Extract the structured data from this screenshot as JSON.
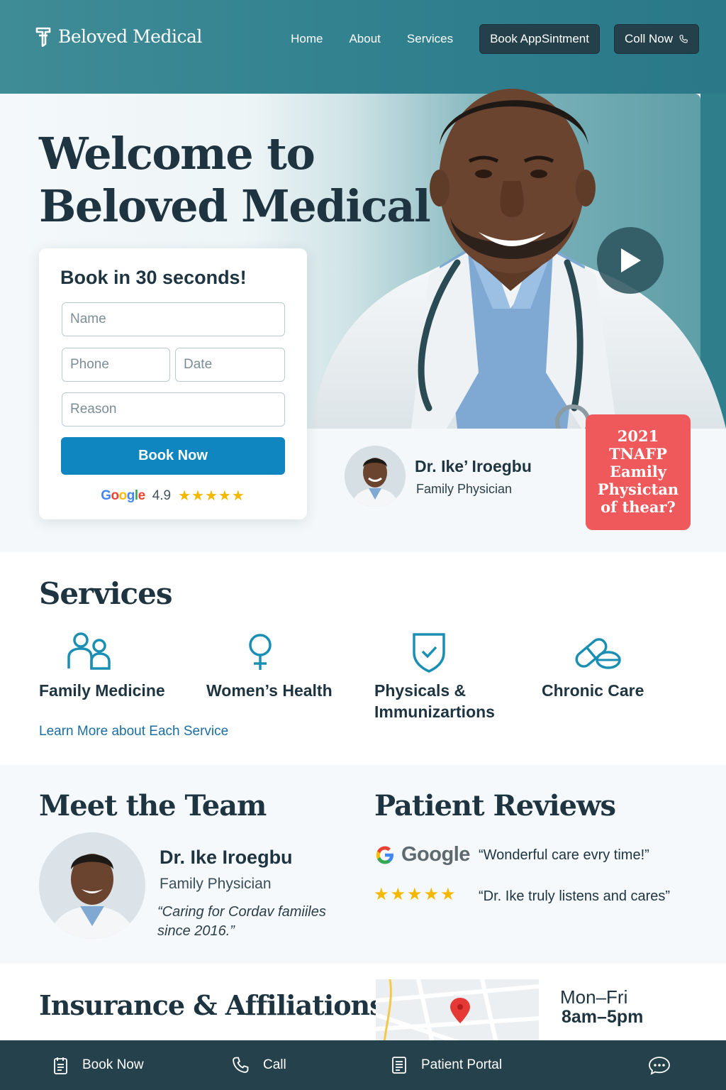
{
  "brand": {
    "name": "Beloved Medical"
  },
  "nav": {
    "links": [
      "Home",
      "About",
      "Services"
    ],
    "book_label": "Book AppSintment",
    "call_label": "Coll Now"
  },
  "hero": {
    "title_line1": "Welcome to",
    "title_line2": "Beloved Medical"
  },
  "booking": {
    "title": "Book in 30 seconds!",
    "name_placeholder": "Name",
    "phone_placeholder": "Phone",
    "date_placeholder": "Date",
    "reason_placeholder": "Reason",
    "button_label": "Book Now",
    "rating_source": "Google",
    "rating_value": "4.9",
    "rating_stars": "★★★★★"
  },
  "doctor_card": {
    "name": "Dr. Ike’ Iroegbu",
    "role": "Family Physician"
  },
  "award": {
    "line1": "2021",
    "line2": "TNAFP",
    "line3": "Eamily",
    "line4": "Physictan",
    "line5": "of thear?"
  },
  "services": {
    "heading": "Services",
    "items": [
      {
        "label": "Family Medicine",
        "icon": "family-icon"
      },
      {
        "label": "Women’s Health",
        "icon": "female-symbol-icon"
      },
      {
        "label_line1": "Physicals &",
        "label_line2": "Immunizartions",
        "icon": "shield-check-icon"
      },
      {
        "label": "Chronic Care",
        "icon": "pill-icon"
      }
    ],
    "learn_more": "Learn More about Each Service"
  },
  "team": {
    "heading": "Meet the Team",
    "name": "Dr. Ike Iroegbu",
    "role": "Family Physician",
    "quote": "“Caring for Cordav famiiles since 2016.”"
  },
  "reviews": {
    "heading": "Patient Reviews",
    "source": "Google",
    "stars": "★★★★★",
    "quote1": "“Wonderful care evry time!”",
    "quote2": "“Dr. Ike truly listens and cares”"
  },
  "insurance": {
    "heading": "Insurance & Affiliations",
    "days": "Mon–Fri",
    "hours": "8am–5pm"
  },
  "bottom_bar": {
    "book": "Book Now",
    "call": "Call",
    "portal": "Patient Portal"
  },
  "colors": {
    "header": "#2f7f8e",
    "primary_button": "#0f86c0",
    "award": "#f0595c",
    "dark": "#1e3440",
    "icon_accent": "#1a8fb3",
    "stars": "#f5b800"
  }
}
